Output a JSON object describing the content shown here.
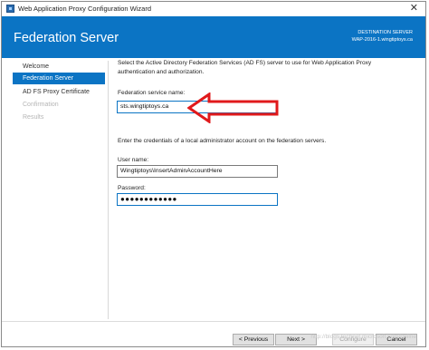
{
  "window": {
    "title": "Web Application Proxy Configuration Wizard",
    "close_glyph": "✕"
  },
  "header": {
    "title": "Federation Server",
    "destination_label": "DESTINATION SERVER",
    "destination_value": "WAP-2016-1.wingtiptoys.ca",
    "color": "#0b74c4"
  },
  "sidebar": {
    "items": [
      {
        "label": "Welcome",
        "state": "normal"
      },
      {
        "label": "Federation Server",
        "state": "selected"
      },
      {
        "label": "AD FS Proxy Certificate",
        "state": "normal"
      },
      {
        "label": "Confirmation",
        "state": "disabled"
      },
      {
        "label": "Results",
        "state": "disabled"
      }
    ]
  },
  "main": {
    "intro": "Select the Active Directory Federation Services (AD FS) server to use for Web Application Proxy authentication and authorization.",
    "service_name_label": "Federation service name:",
    "service_name_value": "sts.wingtiptoys.ca",
    "credentials_intro": "Enter the credentials of a local administrator account on the federation servers.",
    "username_label": "User name:",
    "username_value": "Wingtiptoys\\InsertAdminAccountHere",
    "password_label": "Password:",
    "password_value": "●●●●●●●●●●●●",
    "arrow_color": "#e0191b"
  },
  "footer": {
    "previous_label": "< Previous",
    "next_label": "Next >",
    "configure_label": "Configure",
    "cancel_label": "Cancel",
    "watermark": "http://blogs.technet.microsoft.com/rmilne"
  }
}
